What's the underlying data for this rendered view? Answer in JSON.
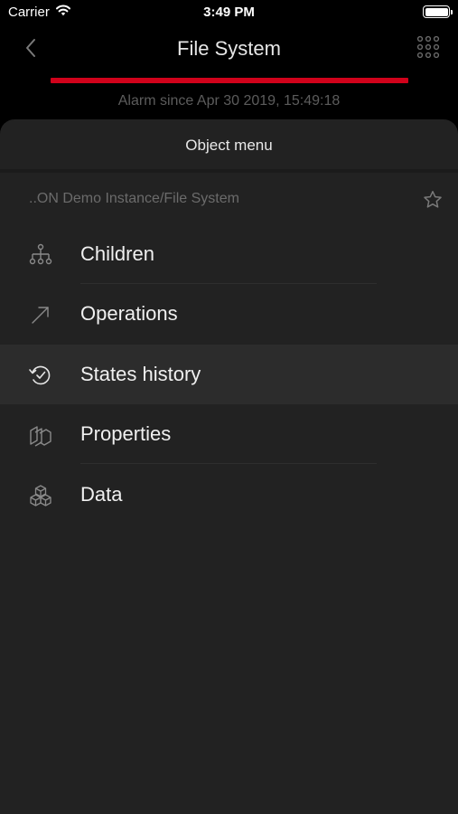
{
  "status_bar": {
    "carrier": "Carrier",
    "time": "3:49 PM"
  },
  "nav": {
    "title": "File System"
  },
  "alarm": {
    "text": "Alarm since Apr 30 2019, 15:49:18",
    "color": "#d0021b"
  },
  "sheet": {
    "title": "Object menu",
    "path": "..ON Demo Instance/File System",
    "items": [
      {
        "label": "Children",
        "icon": "hierarchy-icon"
      },
      {
        "label": "Operations",
        "icon": "arrow-up-right-icon"
      },
      {
        "label": "States history",
        "icon": "history-icon",
        "active": true
      },
      {
        "label": "Properties",
        "icon": "layers-icon"
      },
      {
        "label": "Data",
        "icon": "cubes-icon"
      }
    ]
  }
}
